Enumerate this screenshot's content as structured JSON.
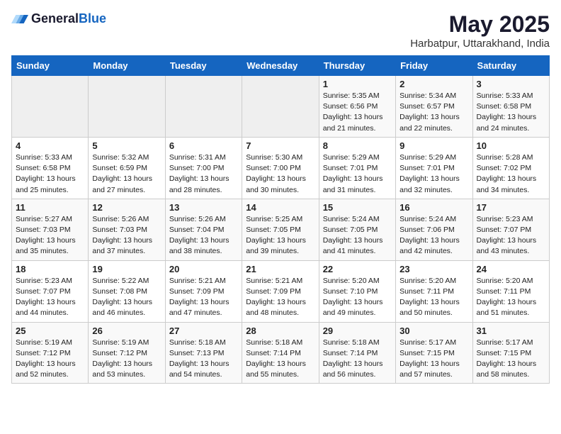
{
  "header": {
    "logo_general": "General",
    "logo_blue": "Blue",
    "title": "May 2025",
    "subtitle": "Harbatpur, Uttarakhand, India"
  },
  "days_of_week": [
    "Sunday",
    "Monday",
    "Tuesday",
    "Wednesday",
    "Thursday",
    "Friday",
    "Saturday"
  ],
  "weeks": [
    [
      {
        "day": "",
        "empty": true
      },
      {
        "day": "",
        "empty": true
      },
      {
        "day": "",
        "empty": true
      },
      {
        "day": "",
        "empty": true
      },
      {
        "day": "1",
        "sunrise": "5:35 AM",
        "sunset": "6:56 PM",
        "daylight": "13 hours and 21 minutes."
      },
      {
        "day": "2",
        "sunrise": "5:34 AM",
        "sunset": "6:57 PM",
        "daylight": "13 hours and 22 minutes."
      },
      {
        "day": "3",
        "sunrise": "5:33 AM",
        "sunset": "6:58 PM",
        "daylight": "13 hours and 24 minutes."
      }
    ],
    [
      {
        "day": "4",
        "sunrise": "5:33 AM",
        "sunset": "6:58 PM",
        "daylight": "13 hours and 25 minutes."
      },
      {
        "day": "5",
        "sunrise": "5:32 AM",
        "sunset": "6:59 PM",
        "daylight": "13 hours and 27 minutes."
      },
      {
        "day": "6",
        "sunrise": "5:31 AM",
        "sunset": "7:00 PM",
        "daylight": "13 hours and 28 minutes."
      },
      {
        "day": "7",
        "sunrise": "5:30 AM",
        "sunset": "7:00 PM",
        "daylight": "13 hours and 30 minutes."
      },
      {
        "day": "8",
        "sunrise": "5:29 AM",
        "sunset": "7:01 PM",
        "daylight": "13 hours and 31 minutes."
      },
      {
        "day": "9",
        "sunrise": "5:29 AM",
        "sunset": "7:01 PM",
        "daylight": "13 hours and 32 minutes."
      },
      {
        "day": "10",
        "sunrise": "5:28 AM",
        "sunset": "7:02 PM",
        "daylight": "13 hours and 34 minutes."
      }
    ],
    [
      {
        "day": "11",
        "sunrise": "5:27 AM",
        "sunset": "7:03 PM",
        "daylight": "13 hours and 35 minutes."
      },
      {
        "day": "12",
        "sunrise": "5:26 AM",
        "sunset": "7:03 PM",
        "daylight": "13 hours and 37 minutes."
      },
      {
        "day": "13",
        "sunrise": "5:26 AM",
        "sunset": "7:04 PM",
        "daylight": "13 hours and 38 minutes."
      },
      {
        "day": "14",
        "sunrise": "5:25 AM",
        "sunset": "7:05 PM",
        "daylight": "13 hours and 39 minutes."
      },
      {
        "day": "15",
        "sunrise": "5:24 AM",
        "sunset": "7:05 PM",
        "daylight": "13 hours and 41 minutes."
      },
      {
        "day": "16",
        "sunrise": "5:24 AM",
        "sunset": "7:06 PM",
        "daylight": "13 hours and 42 minutes."
      },
      {
        "day": "17",
        "sunrise": "5:23 AM",
        "sunset": "7:07 PM",
        "daylight": "13 hours and 43 minutes."
      }
    ],
    [
      {
        "day": "18",
        "sunrise": "5:23 AM",
        "sunset": "7:07 PM",
        "daylight": "13 hours and 44 minutes."
      },
      {
        "day": "19",
        "sunrise": "5:22 AM",
        "sunset": "7:08 PM",
        "daylight": "13 hours and 46 minutes."
      },
      {
        "day": "20",
        "sunrise": "5:21 AM",
        "sunset": "7:09 PM",
        "daylight": "13 hours and 47 minutes."
      },
      {
        "day": "21",
        "sunrise": "5:21 AM",
        "sunset": "7:09 PM",
        "daylight": "13 hours and 48 minutes."
      },
      {
        "day": "22",
        "sunrise": "5:20 AM",
        "sunset": "7:10 PM",
        "daylight": "13 hours and 49 minutes."
      },
      {
        "day": "23",
        "sunrise": "5:20 AM",
        "sunset": "7:11 PM",
        "daylight": "13 hours and 50 minutes."
      },
      {
        "day": "24",
        "sunrise": "5:20 AM",
        "sunset": "7:11 PM",
        "daylight": "13 hours and 51 minutes."
      }
    ],
    [
      {
        "day": "25",
        "sunrise": "5:19 AM",
        "sunset": "7:12 PM",
        "daylight": "13 hours and 52 minutes."
      },
      {
        "day": "26",
        "sunrise": "5:19 AM",
        "sunset": "7:12 PM",
        "daylight": "13 hours and 53 minutes."
      },
      {
        "day": "27",
        "sunrise": "5:18 AM",
        "sunset": "7:13 PM",
        "daylight": "13 hours and 54 minutes."
      },
      {
        "day": "28",
        "sunrise": "5:18 AM",
        "sunset": "7:14 PM",
        "daylight": "13 hours and 55 minutes."
      },
      {
        "day": "29",
        "sunrise": "5:18 AM",
        "sunset": "7:14 PM",
        "daylight": "13 hours and 56 minutes."
      },
      {
        "day": "30",
        "sunrise": "5:17 AM",
        "sunset": "7:15 PM",
        "daylight": "13 hours and 57 minutes."
      },
      {
        "day": "31",
        "sunrise": "5:17 AM",
        "sunset": "7:15 PM",
        "daylight": "13 hours and 58 minutes."
      }
    ]
  ]
}
